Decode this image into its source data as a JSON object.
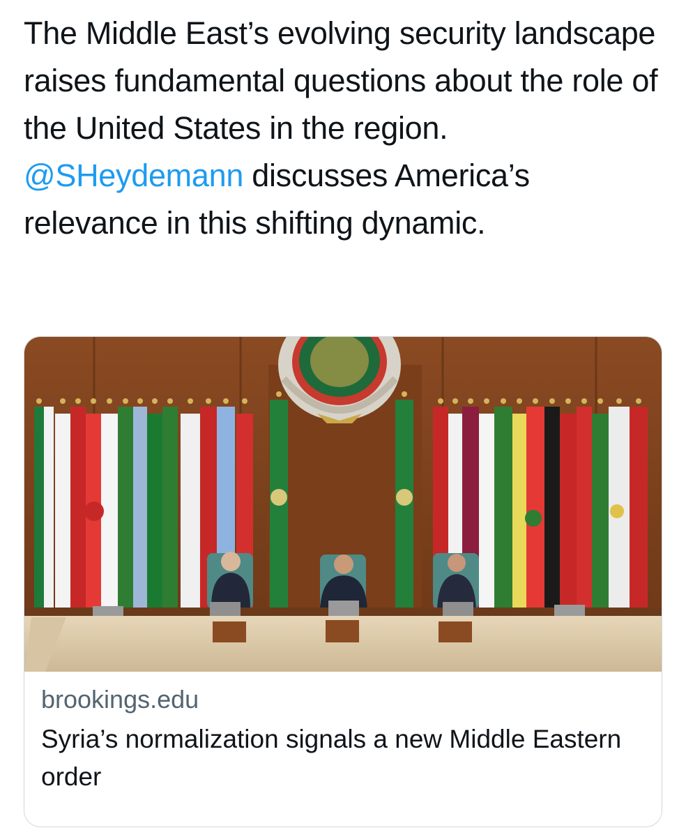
{
  "tweet": {
    "text_part1": "The Middle East’s evolving security landscape raises fundamental questions about the role of the United States in the region. ",
    "mention": "@SHeydemann",
    "text_part2": " discusses America’s relevance in this shifting dynamic."
  },
  "link_card": {
    "image_alt": "Arab League meeting with three officials seated at a podium in front of a row of national flags and the league emblem",
    "domain": "brookings.edu",
    "title": "Syria’s normalization signals a new Middle Eastern order"
  },
  "colors": {
    "text": "#0f1419",
    "mention": "#1d9bf0",
    "secondary_text": "#536471",
    "card_border": "#cfd9de"
  }
}
